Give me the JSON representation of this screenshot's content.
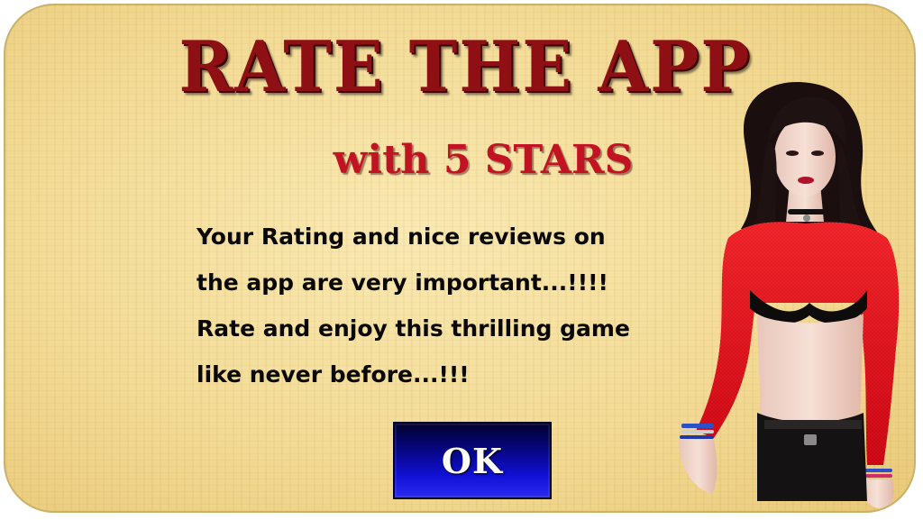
{
  "dialog": {
    "title": "RATE THE APP",
    "subtitle": "with 5 STARS",
    "message_lines": [
      "Your Rating and nice reviews on",
      "the app are very important...!!!!",
      "Rate and enjoy this thrilling game",
      "like never before...!!!"
    ],
    "ok_label": "OK"
  },
  "colors": {
    "parchment": "#f3db96",
    "title": "#8e0f14",
    "subtitle": "#c21323",
    "button": "#0a0aa8",
    "outfit": "#e3101c"
  },
  "images": {
    "model": "woman-in-red-mesh-top-illustration"
  }
}
